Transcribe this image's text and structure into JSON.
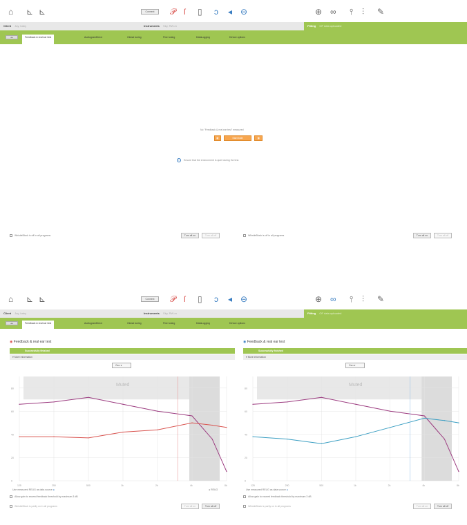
{
  "toolbar": {
    "connect_label": "Connect"
  },
  "infobar": {
    "client_label": "Client",
    "client_value": "Jay, baby",
    "instruments_label": "Instruments",
    "instruments_value": "Sky, RW-m",
    "fitting_label": "Fitting",
    "fitting_value": "OF data uploaded"
  },
  "tabs": [
    {
      "label": "Feedback & real ear test"
    },
    {
      "label": "AudiogramDirect"
    },
    {
      "label": "Global tuning"
    },
    {
      "label": "Fine tuning"
    },
    {
      "label": "DataLogging"
    },
    {
      "label": "Device options"
    }
  ],
  "screen1": {
    "prompt": "No \"Feedback & real ear test\" measured",
    "start_both": "Start both",
    "notice": "Ensure that the environment is quiet during the test.",
    "whistleblock_left": "WhistleBlock is off in all programs",
    "whistleblock_right": "WhistleBlock is off in all programs",
    "turn_all_on": "Turn all on",
    "turn_all_off": "Turn all off"
  },
  "screen2": {
    "left_title": "Feedback & real ear test",
    "right_title": "Feedback & real ear test",
    "status": "Successfully finished",
    "more_info": "More information",
    "dropdown": "Gen",
    "muted": "Muted",
    "allow_gain": "Allow gain to exceed feedback threshold by maximum 3 dB",
    "use_measured": "Use measured REUG as data source",
    "reug": "REUG",
    "x_ticks": [
      "125",
      "250",
      "500",
      "1k",
      "2k",
      "4k",
      "8k"
    ],
    "y_ticks": [
      "80",
      "60",
      "40",
      "20",
      "0"
    ],
    "whistleblock": "WhistleBlock is partly on in all programs",
    "turn_all_on": "Turn all on",
    "turn_all_off": "Turn all off"
  },
  "chart_data": [
    {
      "type": "line",
      "title": "Feedback & real ear test",
      "x": [
        125,
        250,
        500,
        1000,
        2000,
        4000,
        6000,
        8000
      ],
      "series": [
        {
          "values": [
            66,
            68,
            72,
            66,
            60,
            56,
            36,
            8
          ],
          "color": "#9b3a7f"
        },
        {
          "values": [
            38,
            38,
            37,
            42,
            44,
            50,
            48,
            46
          ],
          "color": "#d9534f"
        }
      ],
      "ylim": [
        0,
        90
      ]
    },
    {
      "type": "line",
      "title": "Feedback & real ear test",
      "x": [
        125,
        250,
        500,
        1000,
        2000,
        4000,
        6000,
        8000
      ],
      "series": [
        {
          "values": [
            66,
            68,
            72,
            66,
            60,
            56,
            36,
            8
          ],
          "color": "#9b3a7f"
        },
        {
          "values": [
            38,
            36,
            32,
            38,
            46,
            54,
            52,
            50
          ],
          "color": "#3a9ec2"
        }
      ],
      "ylim": [
        0,
        90
      ]
    }
  ],
  "colors": {
    "accent_green": "#9fc652",
    "orange": "#f7a64f",
    "left_ear_red": "#d9534f",
    "right_ear_blue": "#3a7ec2"
  }
}
